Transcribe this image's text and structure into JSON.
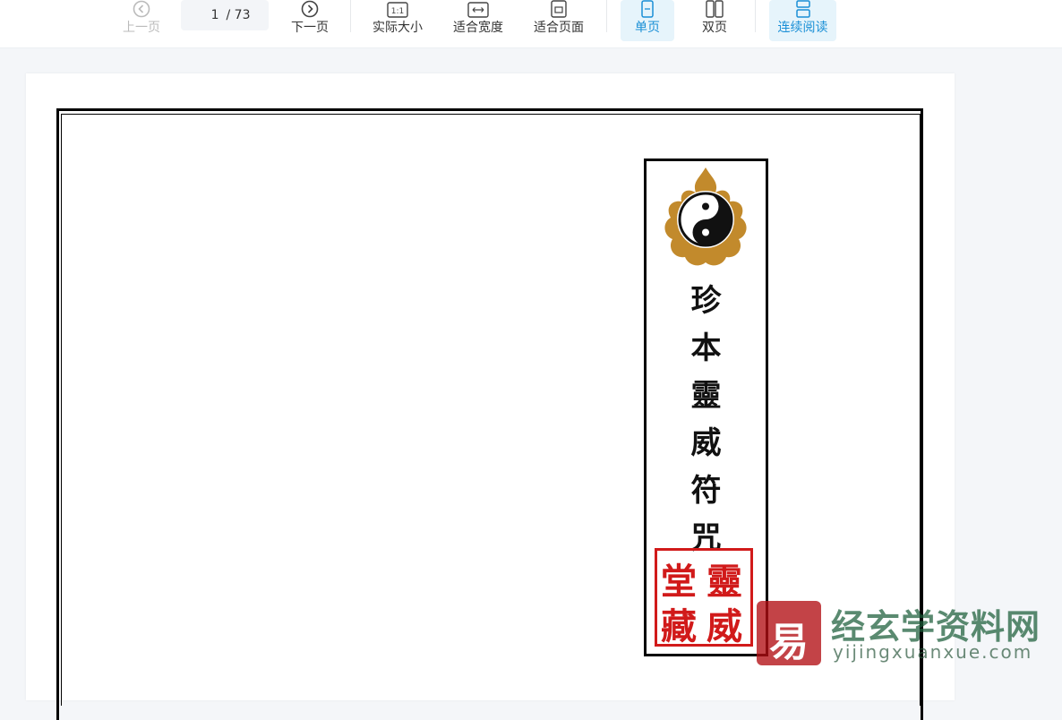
{
  "toolbar": {
    "prev_label": "上一页",
    "page_current": "1",
    "page_total": "/ 73",
    "next_label": "下一页",
    "actual_size_label": "实际大小",
    "actual_size_icon_text": "1:1",
    "fit_width_label": "适合宽度",
    "fit_page_label": "适合页面",
    "single_page_label": "单页",
    "double_page_label": "双页",
    "continuous_label": "连续阅读",
    "accent_color": "#1a8fd6"
  },
  "document": {
    "title_chars": [
      "珍",
      "本",
      "靈",
      "威",
      "符",
      "咒"
    ],
    "seal_chars": [
      "靈",
      "威",
      "堂",
      "藏"
    ]
  },
  "watermark": {
    "logo_char": "易",
    "site_name": "经玄学资料网",
    "site_url": "yijingxuanxue.com"
  }
}
